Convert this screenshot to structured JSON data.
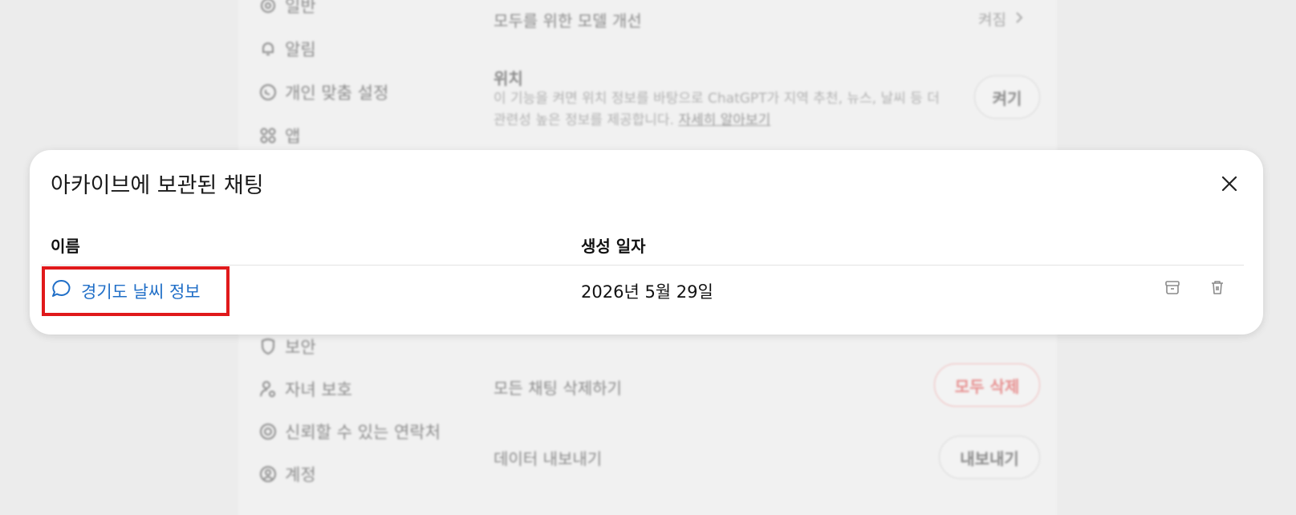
{
  "background_settings": {
    "nav_items": [
      {
        "label": "일반",
        "icon": "gear-icon"
      },
      {
        "label": "알림",
        "icon": "bell-icon"
      },
      {
        "label": "개인 맞춤 설정",
        "icon": "personalization-icon"
      },
      {
        "label": "앱",
        "icon": "apps-grid-icon"
      },
      {
        "label": "보안",
        "icon": "shield-icon"
      },
      {
        "label": "자녀 보호",
        "icon": "parental-control-icon"
      },
      {
        "label": "신뢰할 수 있는 연락처",
        "icon": "lifebuoy-icon"
      },
      {
        "label": "계정",
        "icon": "account-icon"
      }
    ],
    "model_improvement": {
      "label": "모두를 위한 모델 개선",
      "value": "켜짐"
    },
    "location": {
      "title": "위치",
      "description": "이 기능을 켜면 위치 정보를 바탕으로 ChatGPT가 지역 추천, 뉴스, 날씨 등 더 관련성 높은 정보를 제공합니다.",
      "link": "자세히 알아보기",
      "button": "켜기"
    },
    "delete_all": {
      "label": "모든 채팅 삭제하기",
      "button": "모두 삭제"
    },
    "export": {
      "label": "데이터 내보내기",
      "button": "내보내기"
    }
  },
  "modal": {
    "title": "아카이브에 보관된 채팅",
    "columns": {
      "name": "이름",
      "created": "생성 일자"
    },
    "rows": [
      {
        "name": "경기도 날씨 정보",
        "created": "2026년 5월 29일"
      }
    ]
  },
  "colors": {
    "link": "#1f6ec7",
    "highlight": "#e0191b",
    "danger": "#e79090"
  }
}
